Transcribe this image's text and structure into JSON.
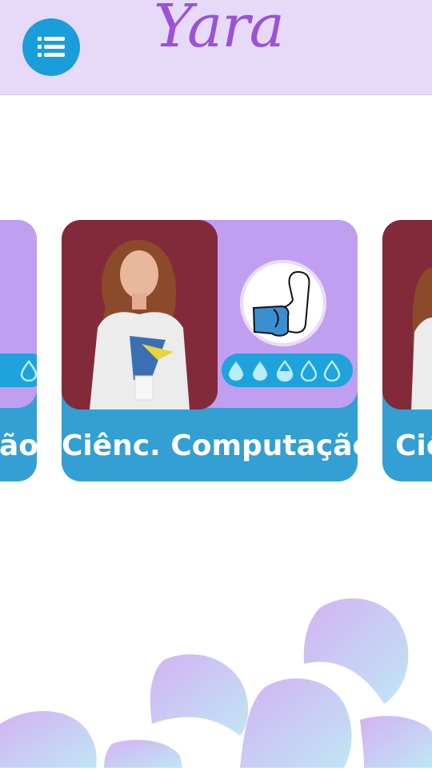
{
  "app": {
    "title": "Yara"
  },
  "header": {
    "menu_icon": "list-menu-icon"
  },
  "carousel": {
    "cards": [
      {
        "label": "Ciênc. Computação",
        "strength_icon": "flexed-arm-icon",
        "level": 2.5,
        "level_max": 5
      }
    ],
    "left_peek_label": "ão",
    "right_peek_label": "Ciê"
  },
  "colors": {
    "header_bg": "#e6daf8",
    "accent_blue": "#1a9ddb",
    "card_purple": "#c09ff0",
    "card_blue": "#339fd2",
    "logo_purple": "#9a52d8"
  }
}
